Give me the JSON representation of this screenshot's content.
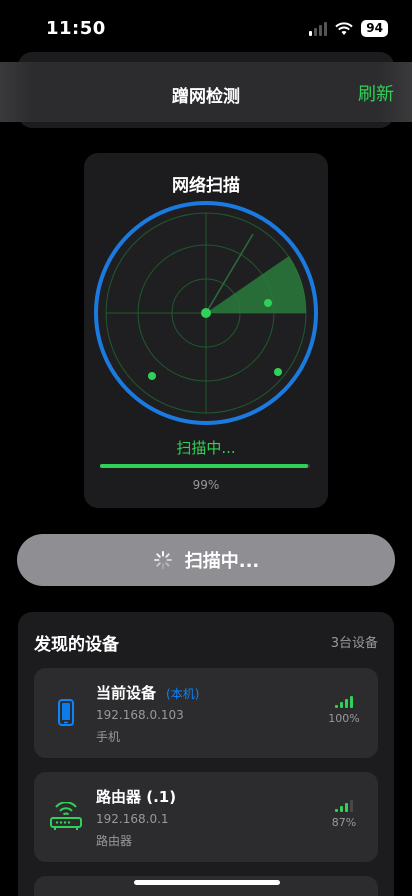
{
  "status_bar": {
    "time": "11:50",
    "battery": "94"
  },
  "nav": {
    "title": "蹭网检测",
    "refresh_label": "刷新"
  },
  "scan_card": {
    "title": "网络扫描",
    "status": "扫描中...",
    "progress_text": "99%",
    "progress_value": 0.99
  },
  "scan_button": {
    "label": "扫描中..."
  },
  "devices": {
    "title": "发现的设备",
    "count": "3台设备",
    "items": [
      {
        "name": "当前设备",
        "tag": "(本机)",
        "ip": "192.168.0.103",
        "type": "手机",
        "signal": "100%",
        "icon": "phone-icon"
      },
      {
        "name": "路由器 (.1)",
        "tag": "",
        "ip": "192.168.0.1",
        "type": "路由器",
        "signal": "87%",
        "icon": "router-icon"
      }
    ]
  },
  "colors": {
    "accent_green": "#30d158",
    "accent_blue": "#0a84ff",
    "radar_ring": "#1a7ae0"
  }
}
